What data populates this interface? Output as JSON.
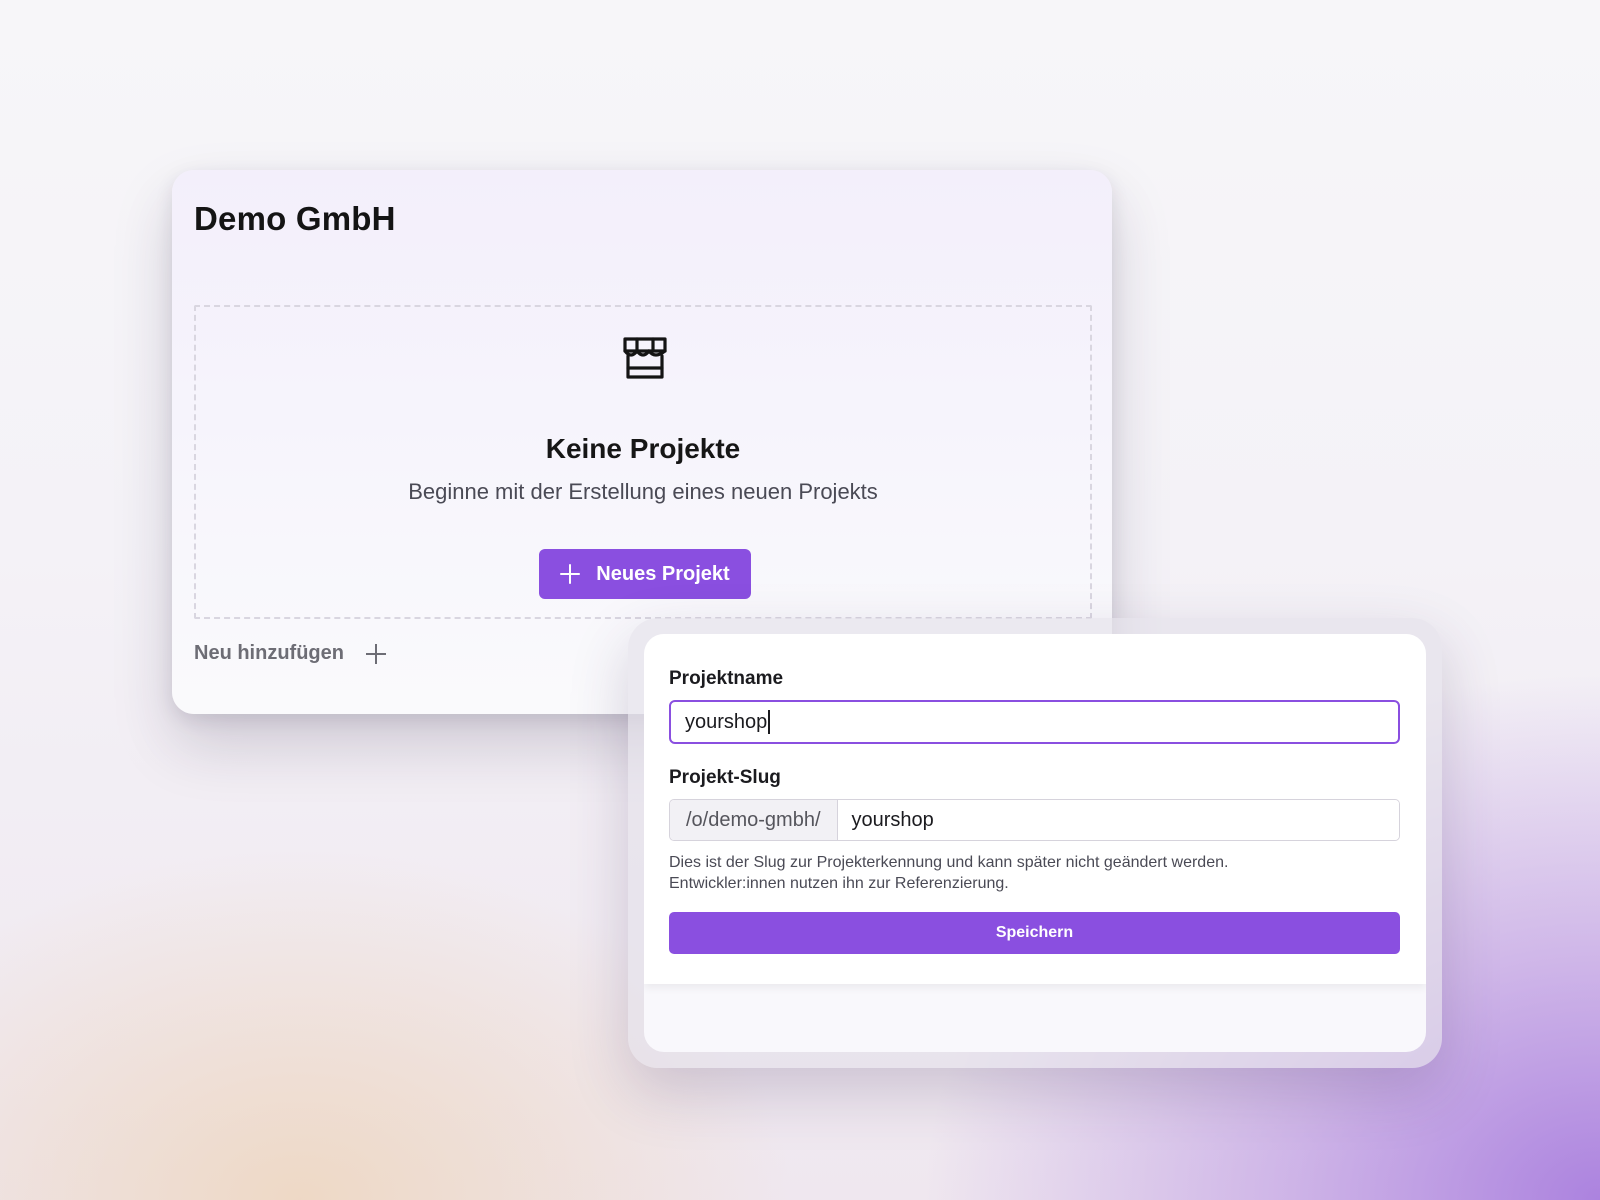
{
  "organization": {
    "name": "Demo GmbH"
  },
  "empty_state": {
    "icon": "storefront-icon",
    "title": "Keine Projekte",
    "subtitle": "Beginne mit der Erstellung eines neuen Projekts",
    "new_project_button": "Neues Projekt"
  },
  "footer": {
    "add_new_label": "Neu hinzufügen"
  },
  "project_form": {
    "name_label": "Projektname",
    "name_value": "yourshop",
    "slug_label": "Projekt-Slug",
    "slug_prefix": "/o/demo-gmbh/",
    "slug_value": "yourshop",
    "hint_line1": "Dies ist der Slug zur Projekterkennung und kann später nicht geändert werden.",
    "hint_line2": "Entwickler:innen nutzen ihn zur Referenzierung.",
    "save_button": "Speichern"
  },
  "colors": {
    "accent": "#8a4fe0"
  }
}
